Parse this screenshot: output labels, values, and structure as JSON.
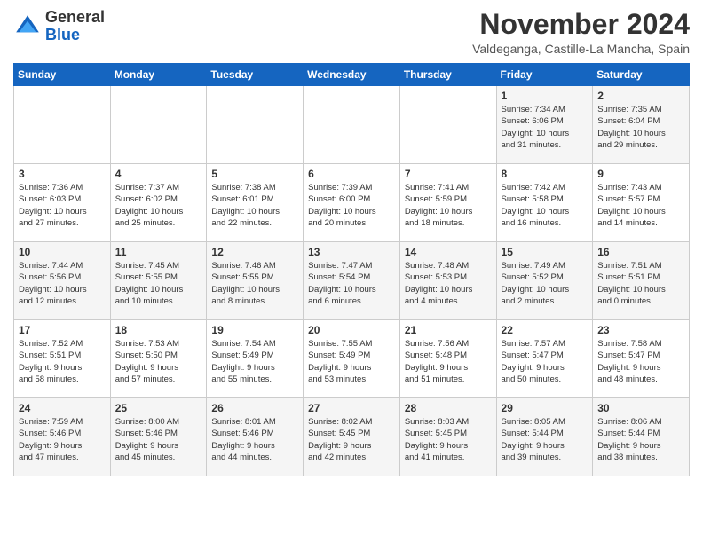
{
  "logo": {
    "general": "General",
    "blue": "Blue"
  },
  "header": {
    "month": "November 2024",
    "location": "Valdeganga, Castille-La Mancha, Spain"
  },
  "weekdays": [
    "Sunday",
    "Monday",
    "Tuesday",
    "Wednesday",
    "Thursday",
    "Friday",
    "Saturday"
  ],
  "weeks": [
    [
      {
        "day": "",
        "info": ""
      },
      {
        "day": "",
        "info": ""
      },
      {
        "day": "",
        "info": ""
      },
      {
        "day": "",
        "info": ""
      },
      {
        "day": "",
        "info": ""
      },
      {
        "day": "1",
        "info": "Sunrise: 7:34 AM\nSunset: 6:06 PM\nDaylight: 10 hours\nand 31 minutes."
      },
      {
        "day": "2",
        "info": "Sunrise: 7:35 AM\nSunset: 6:04 PM\nDaylight: 10 hours\nand 29 minutes."
      }
    ],
    [
      {
        "day": "3",
        "info": "Sunrise: 7:36 AM\nSunset: 6:03 PM\nDaylight: 10 hours\nand 27 minutes."
      },
      {
        "day": "4",
        "info": "Sunrise: 7:37 AM\nSunset: 6:02 PM\nDaylight: 10 hours\nand 25 minutes."
      },
      {
        "day": "5",
        "info": "Sunrise: 7:38 AM\nSunset: 6:01 PM\nDaylight: 10 hours\nand 22 minutes."
      },
      {
        "day": "6",
        "info": "Sunrise: 7:39 AM\nSunset: 6:00 PM\nDaylight: 10 hours\nand 20 minutes."
      },
      {
        "day": "7",
        "info": "Sunrise: 7:41 AM\nSunset: 5:59 PM\nDaylight: 10 hours\nand 18 minutes."
      },
      {
        "day": "8",
        "info": "Sunrise: 7:42 AM\nSunset: 5:58 PM\nDaylight: 10 hours\nand 16 minutes."
      },
      {
        "day": "9",
        "info": "Sunrise: 7:43 AM\nSunset: 5:57 PM\nDaylight: 10 hours\nand 14 minutes."
      }
    ],
    [
      {
        "day": "10",
        "info": "Sunrise: 7:44 AM\nSunset: 5:56 PM\nDaylight: 10 hours\nand 12 minutes."
      },
      {
        "day": "11",
        "info": "Sunrise: 7:45 AM\nSunset: 5:55 PM\nDaylight: 10 hours\nand 10 minutes."
      },
      {
        "day": "12",
        "info": "Sunrise: 7:46 AM\nSunset: 5:55 PM\nDaylight: 10 hours\nand 8 minutes."
      },
      {
        "day": "13",
        "info": "Sunrise: 7:47 AM\nSunset: 5:54 PM\nDaylight: 10 hours\nand 6 minutes."
      },
      {
        "day": "14",
        "info": "Sunrise: 7:48 AM\nSunset: 5:53 PM\nDaylight: 10 hours\nand 4 minutes."
      },
      {
        "day": "15",
        "info": "Sunrise: 7:49 AM\nSunset: 5:52 PM\nDaylight: 10 hours\nand 2 minutes."
      },
      {
        "day": "16",
        "info": "Sunrise: 7:51 AM\nSunset: 5:51 PM\nDaylight: 10 hours\nand 0 minutes."
      }
    ],
    [
      {
        "day": "17",
        "info": "Sunrise: 7:52 AM\nSunset: 5:51 PM\nDaylight: 9 hours\nand 58 minutes."
      },
      {
        "day": "18",
        "info": "Sunrise: 7:53 AM\nSunset: 5:50 PM\nDaylight: 9 hours\nand 57 minutes."
      },
      {
        "day": "19",
        "info": "Sunrise: 7:54 AM\nSunset: 5:49 PM\nDaylight: 9 hours\nand 55 minutes."
      },
      {
        "day": "20",
        "info": "Sunrise: 7:55 AM\nSunset: 5:49 PM\nDaylight: 9 hours\nand 53 minutes."
      },
      {
        "day": "21",
        "info": "Sunrise: 7:56 AM\nSunset: 5:48 PM\nDaylight: 9 hours\nand 51 minutes."
      },
      {
        "day": "22",
        "info": "Sunrise: 7:57 AM\nSunset: 5:47 PM\nDaylight: 9 hours\nand 50 minutes."
      },
      {
        "day": "23",
        "info": "Sunrise: 7:58 AM\nSunset: 5:47 PM\nDaylight: 9 hours\nand 48 minutes."
      }
    ],
    [
      {
        "day": "24",
        "info": "Sunrise: 7:59 AM\nSunset: 5:46 PM\nDaylight: 9 hours\nand 47 minutes."
      },
      {
        "day": "25",
        "info": "Sunrise: 8:00 AM\nSunset: 5:46 PM\nDaylight: 9 hours\nand 45 minutes."
      },
      {
        "day": "26",
        "info": "Sunrise: 8:01 AM\nSunset: 5:46 PM\nDaylight: 9 hours\nand 44 minutes."
      },
      {
        "day": "27",
        "info": "Sunrise: 8:02 AM\nSunset: 5:45 PM\nDaylight: 9 hours\nand 42 minutes."
      },
      {
        "day": "28",
        "info": "Sunrise: 8:03 AM\nSunset: 5:45 PM\nDaylight: 9 hours\nand 41 minutes."
      },
      {
        "day": "29",
        "info": "Sunrise: 8:05 AM\nSunset: 5:44 PM\nDaylight: 9 hours\nand 39 minutes."
      },
      {
        "day": "30",
        "info": "Sunrise: 8:06 AM\nSunset: 5:44 PM\nDaylight: 9 hours\nand 38 minutes."
      }
    ]
  ]
}
